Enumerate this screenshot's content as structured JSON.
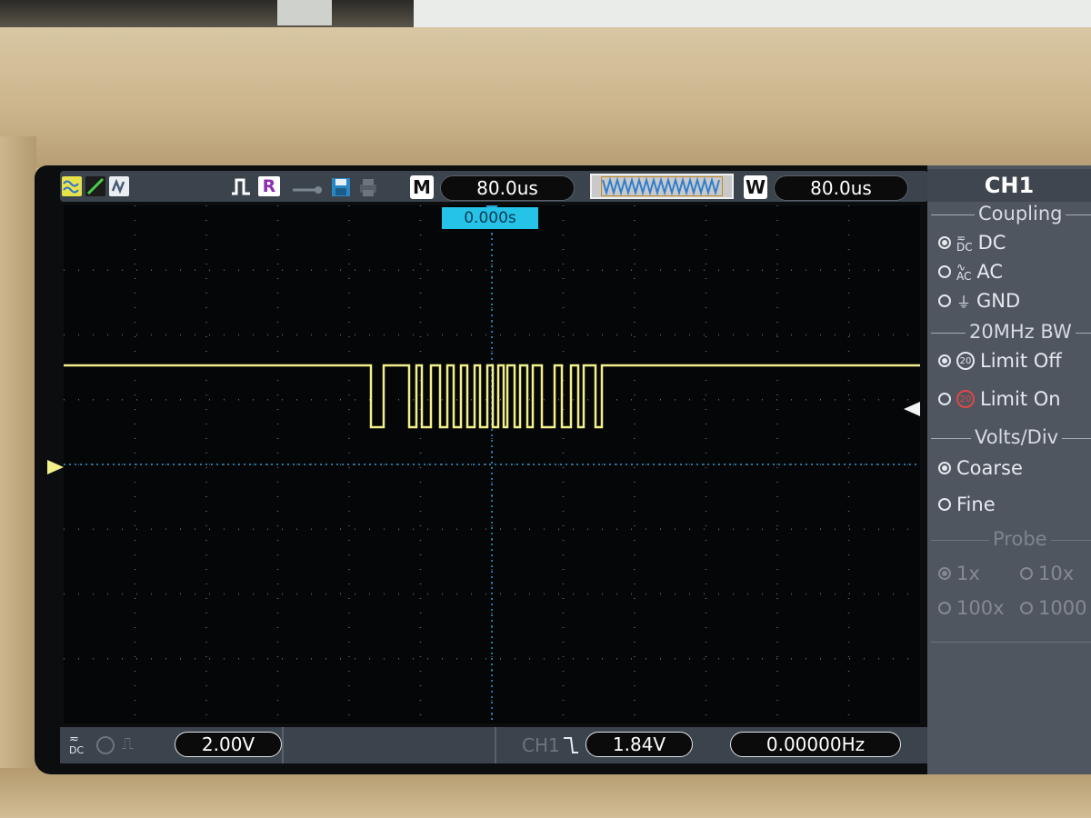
{
  "status_bar": {
    "mode_box": "M",
    "timebase": "80.0us",
    "window_box": "W",
    "window_timebase": "80.0us",
    "run_indicator": "R",
    "trigger_time": "0.000s"
  },
  "channel_menu": {
    "title": "CH1",
    "coupling": {
      "heading": "Coupling",
      "options": [
        "DC",
        "AC",
        "GND"
      ],
      "selected": "DC"
    },
    "bandwidth": {
      "heading": "20MHz BW",
      "options": [
        "Limit Off",
        "Limit On"
      ],
      "selected": "Limit Off"
    },
    "volts_div": {
      "heading": "Volts/Div",
      "options": [
        "Coarse",
        "Fine"
      ],
      "selected": "Coarse"
    },
    "probe": {
      "heading": "Probe",
      "options": [
        "1x",
        "10x",
        "100x",
        "1000"
      ],
      "selected": "1x"
    }
  },
  "bottom_bar": {
    "ch1_scale": "2.00V",
    "trigger_source": "CH1",
    "trigger_level": "1.84V",
    "frequency": "0.00000Hz"
  },
  "colors": {
    "trace": "#f2f08a",
    "graticule": "#2a9fd6",
    "menu_bg": "#4f5660"
  }
}
